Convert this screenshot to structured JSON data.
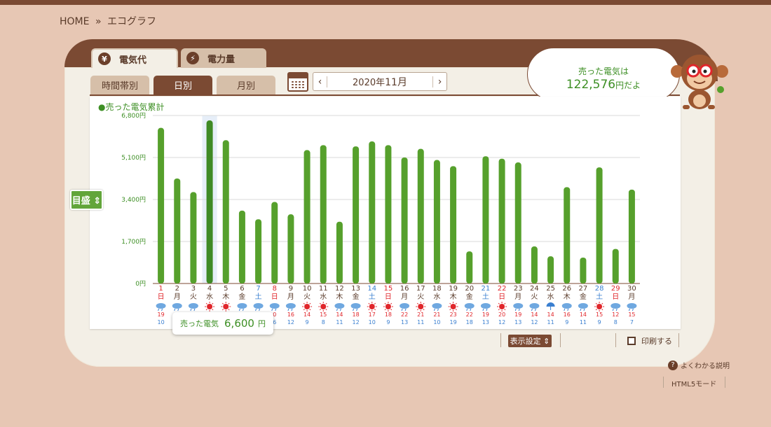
{
  "breadcrumb": {
    "home": "HOME",
    "sep": "»",
    "current": "エコグラフ"
  },
  "main_tabs": [
    {
      "label": "電気代",
      "icon": "¥"
    },
    {
      "label": "電力量",
      "icon": "⚡"
    }
  ],
  "sub_tabs": [
    {
      "label": "時間帯別"
    },
    {
      "label": "日別"
    },
    {
      "label": "月別"
    }
  ],
  "date_nav": {
    "prev": "‹",
    "next": "›",
    "year": "2020年",
    "month": "11月"
  },
  "legend": "●売った電気累計",
  "meter_button": "目盛 ⇕",
  "bubble": {
    "line1": "売った電気は",
    "amount": "122,576",
    "suffix": "円だよ"
  },
  "tooltip": {
    "label": "売った電気",
    "value": "6,600",
    "unit": "円"
  },
  "controls": {
    "display_settings": "表示設定 ⇕",
    "print": "印刷する"
  },
  "footer": {
    "help": "よくわかる説明",
    "html5": "HTML5モード"
  },
  "colors": {
    "bar": "#56a02c",
    "bar_highlight": "#3f8a25",
    "sunday": "#e0262b",
    "saturday": "#3a7fd0",
    "weekday": "#5a3b2a",
    "brown": "#7b4a33"
  },
  "chart_data": {
    "type": "bar",
    "ylim": [
      0,
      6800
    ],
    "yticks": [
      "0円",
      "1,700円",
      "3,400円",
      "5,100円",
      "6,800円"
    ],
    "highlight_index": 3,
    "days": [
      {
        "d": "1",
        "w": "日",
        "v": 6300,
        "hi": "19",
        "lo": "10",
        "wx": "rain"
      },
      {
        "d": "2",
        "w": "月",
        "v": 4250,
        "hi": "",
        "lo": "",
        "wx": "rain"
      },
      {
        "d": "3",
        "w": "火",
        "v": 3700,
        "hi": "",
        "lo": "",
        "wx": "rain"
      },
      {
        "d": "4",
        "w": "水",
        "v": 6600,
        "hi": "",
        "lo": "",
        "wx": "sun"
      },
      {
        "d": "5",
        "w": "木",
        "v": 5800,
        "hi": "",
        "lo": "",
        "wx": "sun"
      },
      {
        "d": "6",
        "w": "金",
        "v": 2950,
        "hi": "",
        "lo": "",
        "wx": "rain"
      },
      {
        "d": "7",
        "w": "土",
        "v": 2600,
        "hi": "",
        "lo": "6",
        "wx": "rain"
      },
      {
        "d": "8",
        "w": "日",
        "v": 3300,
        "hi": "0",
        "lo": "6",
        "wx": "rain"
      },
      {
        "d": "9",
        "w": "月",
        "v": 2800,
        "hi": "16",
        "lo": "12",
        "wx": "rain"
      },
      {
        "d": "10",
        "w": "火",
        "v": 5400,
        "hi": "14",
        "lo": "9",
        "wx": "sun"
      },
      {
        "d": "11",
        "w": "水",
        "v": 5600,
        "hi": "15",
        "lo": "8",
        "wx": "sun"
      },
      {
        "d": "12",
        "w": "木",
        "v": 2500,
        "hi": "14",
        "lo": "11",
        "wx": "rain"
      },
      {
        "d": "13",
        "w": "金",
        "v": 5550,
        "hi": "18",
        "lo": "12",
        "wx": "rain"
      },
      {
        "d": "14",
        "w": "土",
        "v": 5750,
        "hi": "17",
        "lo": "10",
        "wx": "sun"
      },
      {
        "d": "15",
        "w": "日",
        "v": 5600,
        "hi": "18",
        "lo": "9",
        "wx": "sun"
      },
      {
        "d": "16",
        "w": "月",
        "v": 5100,
        "hi": "22",
        "lo": "13",
        "wx": "rain"
      },
      {
        "d": "17",
        "w": "火",
        "v": 5450,
        "hi": "21",
        "lo": "11",
        "wx": "sun"
      },
      {
        "d": "18",
        "w": "水",
        "v": 5000,
        "hi": "21",
        "lo": "10",
        "wx": "rain"
      },
      {
        "d": "19",
        "w": "木",
        "v": 4750,
        "hi": "23",
        "lo": "19",
        "wx": "sun"
      },
      {
        "d": "20",
        "w": "金",
        "v": 1300,
        "hi": "22",
        "lo": "18",
        "wx": "rain"
      },
      {
        "d": "21",
        "w": "土",
        "v": 5150,
        "hi": "19",
        "lo": "13",
        "wx": "rain"
      },
      {
        "d": "22",
        "w": "日",
        "v": 5050,
        "hi": "20",
        "lo": "12",
        "wx": "sun"
      },
      {
        "d": "23",
        "w": "月",
        "v": 4900,
        "hi": "19",
        "lo": "13",
        "wx": "rain"
      },
      {
        "d": "24",
        "w": "火",
        "v": 1500,
        "hi": "14",
        "lo": "12",
        "wx": "rain"
      },
      {
        "d": "25",
        "w": "水",
        "v": 1100,
        "hi": "14",
        "lo": "11",
        "wx": "umbrella"
      },
      {
        "d": "26",
        "w": "木",
        "v": 3900,
        "hi": "16",
        "lo": "9",
        "wx": "rain"
      },
      {
        "d": "27",
        "w": "金",
        "v": 1050,
        "hi": "14",
        "lo": "11",
        "wx": "rain"
      },
      {
        "d": "28",
        "w": "土",
        "v": 4700,
        "hi": "15",
        "lo": "9",
        "wx": "sun"
      },
      {
        "d": "29",
        "w": "日",
        "v": 1400,
        "hi": "12",
        "lo": "8",
        "wx": "rain"
      },
      {
        "d": "30",
        "w": "月",
        "v": 3800,
        "hi": "15",
        "lo": "7",
        "wx": "rain"
      }
    ]
  }
}
